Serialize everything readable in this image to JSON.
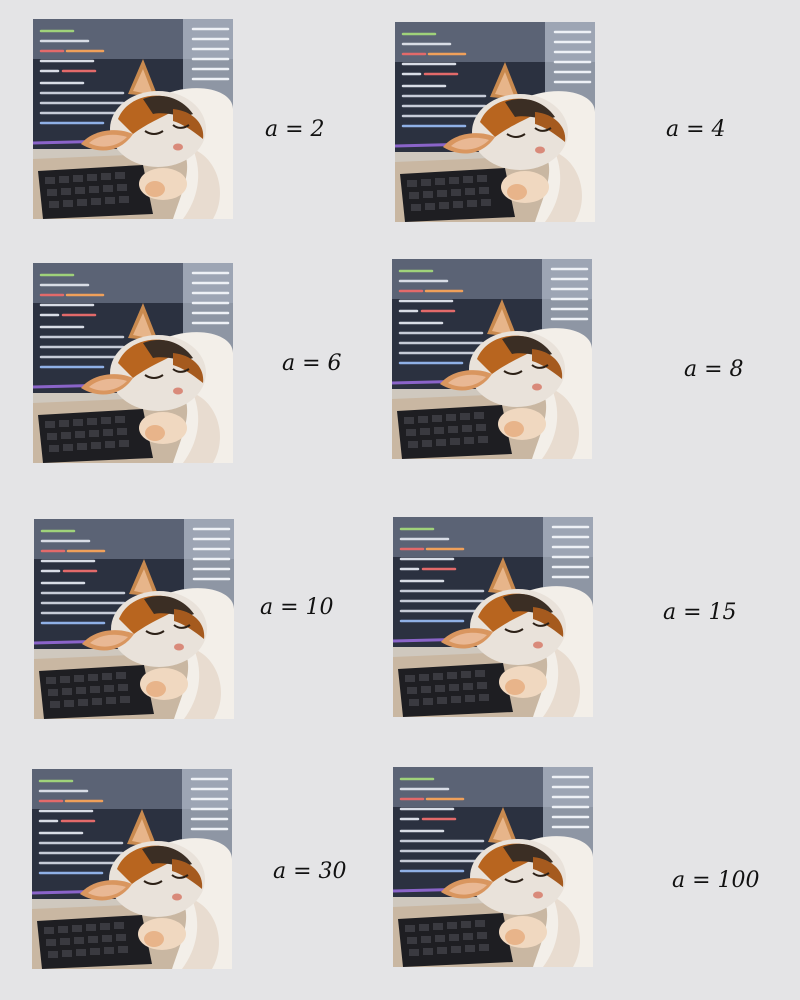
{
  "images": [
    {
      "label": "a = 2"
    },
    {
      "label": "a = 4"
    },
    {
      "label": "a = 6"
    },
    {
      "label": "a = 8"
    },
    {
      "label": "a = 10"
    },
    {
      "label": "a = 15"
    },
    {
      "label": "a = 30"
    },
    {
      "label": "a = 100"
    }
  ]
}
